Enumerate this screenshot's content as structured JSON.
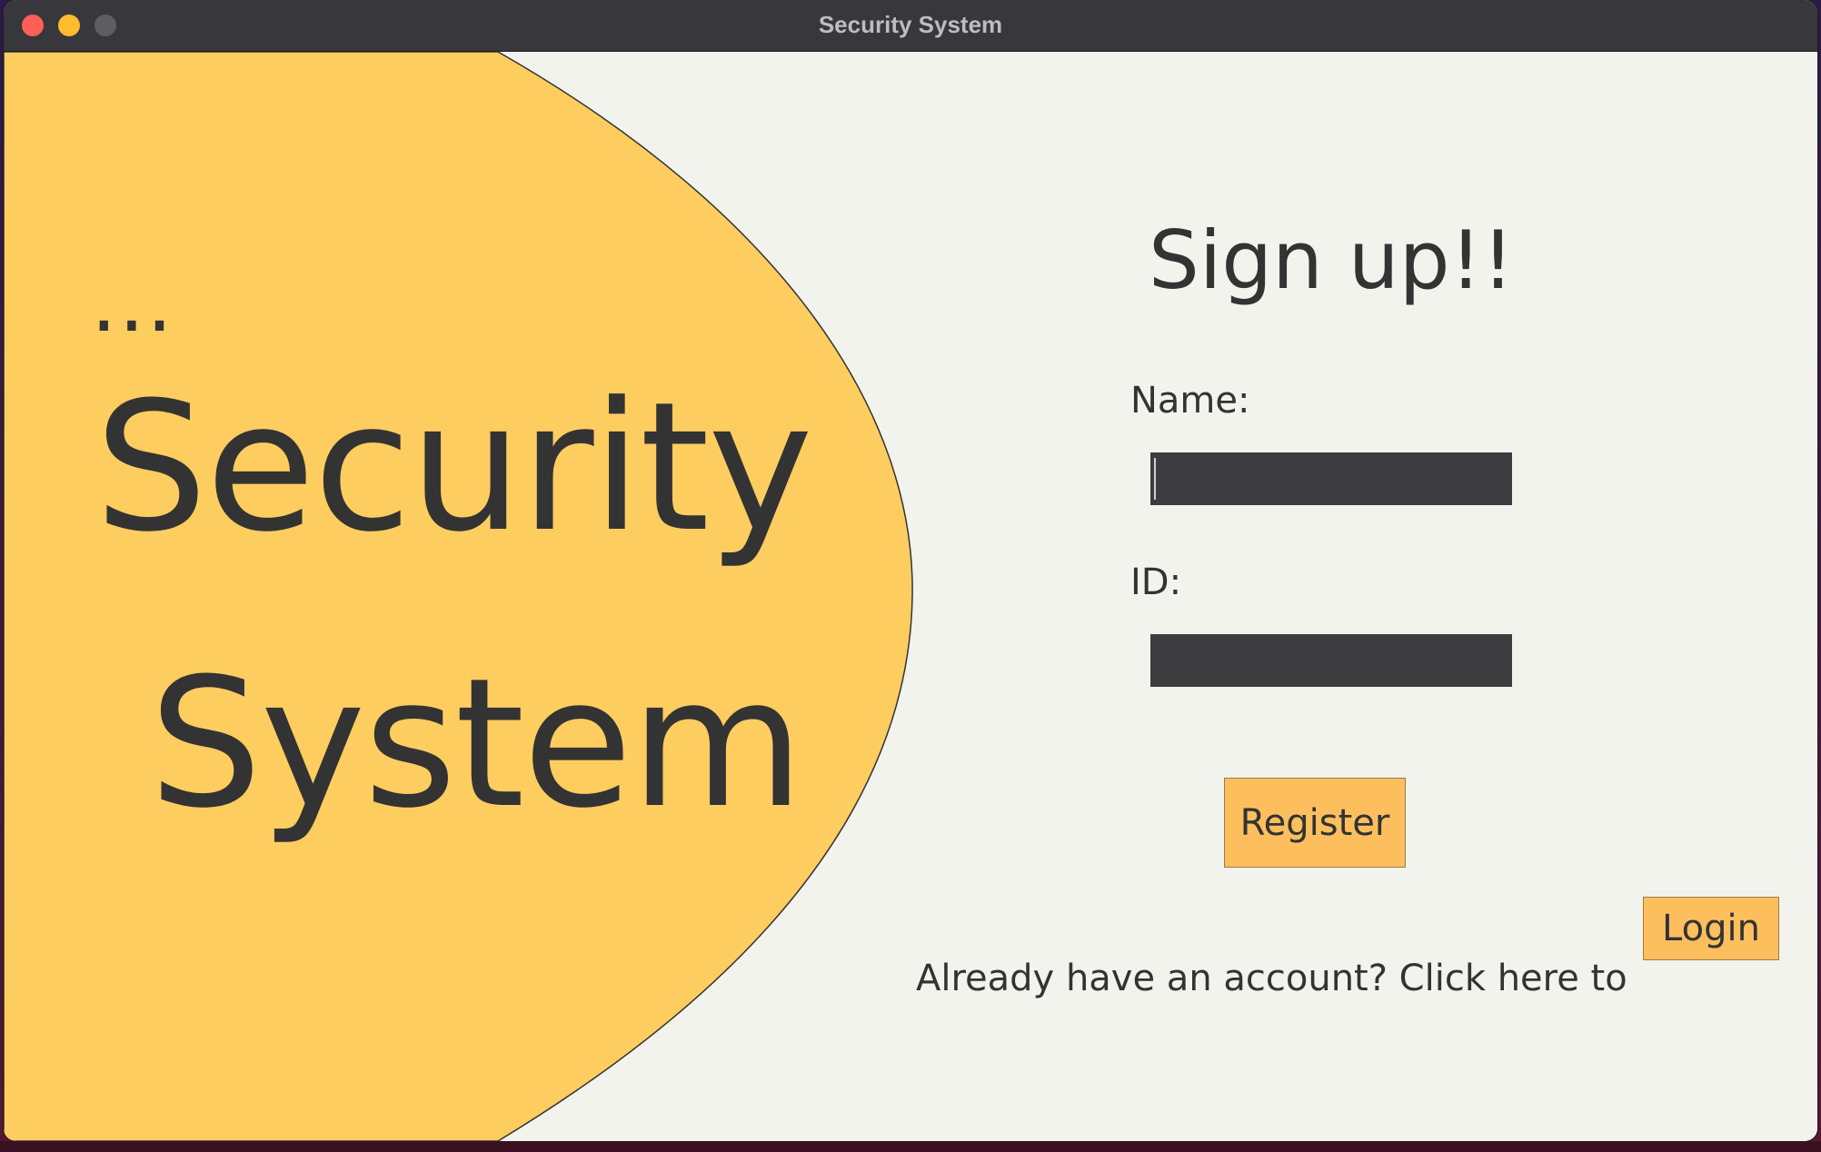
{
  "window": {
    "title": "Security System"
  },
  "brand": {
    "dots": "...",
    "line1": "Security",
    "line2": "System"
  },
  "form": {
    "title": "Sign up!!",
    "name_label": "Name:",
    "name_value": "",
    "id_label": "ID:",
    "id_value": "",
    "register_label": "Register",
    "login_prompt": "Already have an account? Click here to",
    "login_label": "Login"
  },
  "colors": {
    "accent_yellow": "#fecd60",
    "button_orange": "#fdbf5e",
    "input_dark": "#3d3d3f",
    "text_dark": "#333333",
    "background": "#f3f3ee"
  }
}
